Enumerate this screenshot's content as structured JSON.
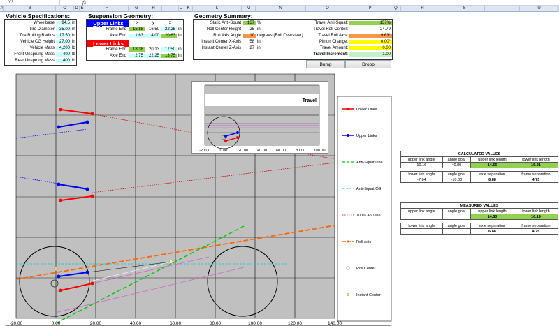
{
  "formula_bar": {
    "cell_ref": "Y3",
    "fx_label": "fx",
    "formula": ""
  },
  "columns": [
    "A",
    "B",
    "C",
    "D",
    "E",
    "F",
    "G",
    "H",
    "I",
    "J",
    "K",
    "L",
    "M",
    "N",
    "O",
    "P",
    "Q",
    "R",
    "S",
    "T",
    "U"
  ],
  "vehicle_specs": {
    "title": "Vehicle Specifications:",
    "rows": [
      {
        "label": "Wheelbase",
        "value": "94.5",
        "unit": "in"
      },
      {
        "label": "Tire Diameter",
        "value": "35.00",
        "unit": "in"
      },
      {
        "label": "Tire Rolling Radius",
        "value": "17.50",
        "unit": "in"
      },
      {
        "label": "Vehicle CG Height",
        "value": "27.00",
        "unit": "in"
      },
      {
        "label": "Vehicle Mass",
        "value": "4,200",
        "unit": "lb"
      },
      {
        "label": "Front Unsprung Mass",
        "value": "400",
        "unit": "lb"
      },
      {
        "label": "Rear Unsprung Mass",
        "value": "400",
        "unit": "lb"
      }
    ]
  },
  "suspension": {
    "title": "Suspension Geometry:",
    "upper_title": "Upper Links",
    "lower_title": "Lower Links",
    "axis_headers": [
      "x",
      "y",
      "z"
    ],
    "upper_rows": [
      {
        "label": "Frame End",
        "x": "15.88",
        "y": "16.50",
        "z": "22.25",
        "unit": "in"
      },
      {
        "label": "Axle End",
        "x": "1.63",
        "y": "14.00",
        "z": "20.63",
        "unit": "in"
      }
    ],
    "lower_rows": [
      {
        "label": "Frame End",
        "x": "18.38",
        "y": "20.13",
        "z": "17.50",
        "unit": "in"
      },
      {
        "label": "Axle End",
        "x": "2.75",
        "y": "22.25",
        "z": "13.75",
        "unit": "in"
      }
    ]
  },
  "geometry_summary": {
    "title": "Geometry Summary:",
    "left_rows": [
      {
        "label": "Static Anti-Squat",
        "value": "157",
        "unit": "%"
      },
      {
        "label": "Roll Center Height",
        "value": "25",
        "unit": "in"
      },
      {
        "label": "Roll Axis Angle",
        "value": "10",
        "unit": "degrees (Roll Oversteer)"
      },
      {
        "label": "Instant Center X-Axis",
        "value": "58",
        "unit": "in"
      },
      {
        "label": "Instant Center Z-Axis",
        "value": "27",
        "unit": "in"
      }
    ],
    "right_rows": [
      {
        "label": "Travel Anti-Squat:",
        "value": "157%"
      },
      {
        "label": "Travel Roll Center:",
        "value": "24.79"
      },
      {
        "label": "Travel Roll Axis:",
        "value": "9.63°"
      },
      {
        "label": "Pinion Change:",
        "value": "0.00°"
      },
      {
        "label": "Travel Amount:",
        "value": "0.00"
      },
      {
        "label": "Travel Increment:",
        "value": "1.00"
      }
    ],
    "buttons": [
      "Bump",
      "Droop"
    ]
  },
  "main_chart": {
    "x_ticks": [
      "-20.00",
      "0.00",
      "20.00",
      "40.00",
      "60.00",
      "80.00",
      "100.00",
      "120.00",
      "140.00"
    ],
    "legend": [
      "Lower Links",
      "Upper Links",
      "Anti-Squat Line",
      "Anti-Squat CG",
      "100% AS Line",
      "Roll Axis",
      "Roll Center",
      "Instant Center"
    ],
    "colors": {
      "lower": "#ff0000",
      "upper": "#0000ff",
      "anti_squat": "#00cc00",
      "as_cg": "#00cccc",
      "as100": "#cc0000",
      "roll_axis": "#ff6600",
      "roll_center": "#000000",
      "instant_center": "#ffcc66",
      "plot_bg": "#c0c0c0"
    }
  },
  "travel_chart": {
    "title": "Travel",
    "x_ticks": [
      "-20.00",
      "0.00",
      "20.00",
      "40.00",
      "60.00",
      "80.00",
      "100.00"
    ]
  },
  "calculated": {
    "title": "CALCULATED VALUES",
    "h1": [
      "upper link angle",
      "angle goal",
      "upper link length",
      "lower link length"
    ],
    "r1": [
      "10.16",
      "40.00",
      "14.56",
      "16.21"
    ],
    "h2": [
      "lower link angle",
      "angle goal",
      "axle separation",
      "frame separation"
    ],
    "r2": [
      "-7.84",
      "-10.00",
      "6.88",
      "4.75"
    ]
  },
  "measured": {
    "title": "MEASURED VALUES",
    "h1": [
      "upper link angle",
      "angle goal",
      "upper link length",
      "lower link length"
    ],
    "r1": [
      "",
      "",
      "14.50",
      "16.19"
    ],
    "h2": [
      "lower link angle",
      "angle goal",
      "axle separation",
      "frame separation"
    ],
    "r2": [
      "",
      "",
      "6.88",
      "4.75"
    ]
  }
}
